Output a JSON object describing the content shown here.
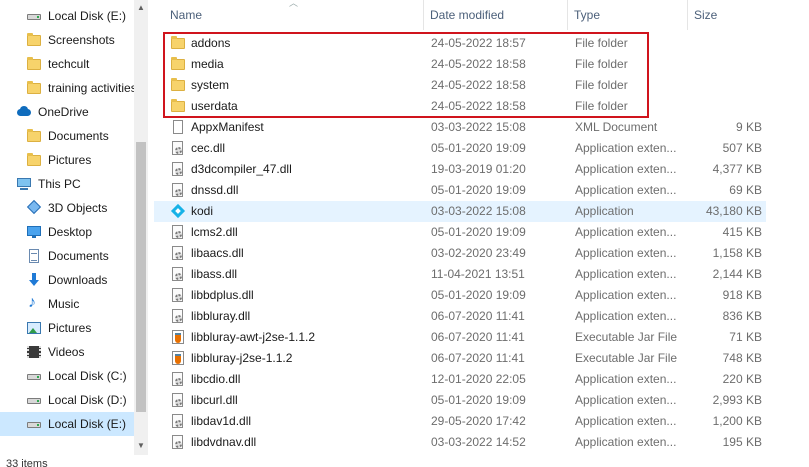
{
  "nav": {
    "items": [
      {
        "label": "Local Disk (E:)",
        "icon": "drive-icon",
        "indent": "sub"
      },
      {
        "label": "Screenshots",
        "icon": "folder-icon",
        "indent": "sub"
      },
      {
        "label": "techcult",
        "icon": "folder-icon",
        "indent": "sub"
      },
      {
        "label": "training activities",
        "icon": "folder-icon",
        "indent": "sub"
      },
      {
        "label": "OneDrive",
        "icon": "cloud-icon",
        "indent": "top"
      },
      {
        "label": "Documents",
        "icon": "folder-icon",
        "indent": "sub"
      },
      {
        "label": "Pictures",
        "icon": "folder-icon",
        "indent": "sub"
      },
      {
        "label": "This PC",
        "icon": "pc-icon",
        "indent": "top"
      },
      {
        "label": "3D Objects",
        "icon": "cube-icon",
        "indent": "sub"
      },
      {
        "label": "Desktop",
        "icon": "desk-icon",
        "indent": "sub"
      },
      {
        "label": "Documents",
        "icon": "doc-icon",
        "indent": "sub"
      },
      {
        "label": "Downloads",
        "icon": "dl-icon",
        "indent": "sub"
      },
      {
        "label": "Music",
        "icon": "music-icon",
        "indent": "sub"
      },
      {
        "label": "Pictures",
        "icon": "pic-icon",
        "indent": "sub"
      },
      {
        "label": "Videos",
        "icon": "vid-icon",
        "indent": "sub"
      },
      {
        "label": "Local Disk (C:)",
        "icon": "drive-icon",
        "indent": "sub"
      },
      {
        "label": "Local Disk (D:)",
        "icon": "drive-icon",
        "indent": "sub"
      },
      {
        "label": "Local Disk (E:)",
        "icon": "drive-icon",
        "indent": "sub",
        "selected": true
      }
    ]
  },
  "columns": {
    "name": "Name",
    "date": "Date modified",
    "type": "Type",
    "size": "Size"
  },
  "files": [
    {
      "name": "addons",
      "date": "24-05-2022 18:57",
      "type": "File folder",
      "size": "",
      "icon": "folder-icon"
    },
    {
      "name": "media",
      "date": "24-05-2022 18:58",
      "type": "File folder",
      "size": "",
      "icon": "folder-icon"
    },
    {
      "name": "system",
      "date": "24-05-2022 18:58",
      "type": "File folder",
      "size": "",
      "icon": "folder-icon"
    },
    {
      "name": "userdata",
      "date": "24-05-2022 18:58",
      "type": "File folder",
      "size": "",
      "icon": "folder-icon"
    },
    {
      "name": "AppxManifest",
      "date": "03-03-2022 15:08",
      "type": "XML Document",
      "size": "9 KB",
      "icon": "file-icon"
    },
    {
      "name": "cec.dll",
      "date": "05-01-2020 19:09",
      "type": "Application exten...",
      "size": "507 KB",
      "icon": "dll-icon"
    },
    {
      "name": "d3dcompiler_47.dll",
      "date": "19-03-2019 01:20",
      "type": "Application exten...",
      "size": "4,377 KB",
      "icon": "dll-icon"
    },
    {
      "name": "dnssd.dll",
      "date": "05-01-2020 19:09",
      "type": "Application exten...",
      "size": "69 KB",
      "icon": "dll-icon"
    },
    {
      "name": "kodi",
      "date": "03-03-2022 15:08",
      "type": "Application",
      "size": "43,180 KB",
      "icon": "kodi-icon",
      "highlight": true
    },
    {
      "name": "lcms2.dll",
      "date": "05-01-2020 19:09",
      "type": "Application exten...",
      "size": "415 KB",
      "icon": "dll-icon"
    },
    {
      "name": "libaacs.dll",
      "date": "03-02-2020 23:49",
      "type": "Application exten...",
      "size": "1,158 KB",
      "icon": "dll-icon"
    },
    {
      "name": "libass.dll",
      "date": "11-04-2021 13:51",
      "type": "Application exten...",
      "size": "2,144 KB",
      "icon": "dll-icon"
    },
    {
      "name": "libbdplus.dll",
      "date": "05-01-2020 19:09",
      "type": "Application exten...",
      "size": "918 KB",
      "icon": "dll-icon"
    },
    {
      "name": "libbluray.dll",
      "date": "06-07-2020 11:41",
      "type": "Application exten...",
      "size": "836 KB",
      "icon": "dll-icon"
    },
    {
      "name": "libbluray-awt-j2se-1.1.2",
      "date": "06-07-2020 11:41",
      "type": "Executable Jar File",
      "size": "71 KB",
      "icon": "jar-icon"
    },
    {
      "name": "libbluray-j2se-1.1.2",
      "date": "06-07-2020 11:41",
      "type": "Executable Jar File",
      "size": "748 KB",
      "icon": "jar-icon"
    },
    {
      "name": "libcdio.dll",
      "date": "12-01-2020 22:05",
      "type": "Application exten...",
      "size": "220 KB",
      "icon": "dll-icon"
    },
    {
      "name": "libcurl.dll",
      "date": "05-01-2020 19:09",
      "type": "Application exten...",
      "size": "2,993 KB",
      "icon": "dll-icon"
    },
    {
      "name": "libdav1d.dll",
      "date": "29-05-2020 17:42",
      "type": "Application exten...",
      "size": "1,200 KB",
      "icon": "dll-icon"
    },
    {
      "name": "libdvdnav.dll",
      "date": "03-03-2022 14:52",
      "type": "Application exten...",
      "size": "195 KB",
      "icon": "dll-icon"
    }
  ],
  "status": {
    "item_count": "33 items"
  },
  "colors": {
    "highlight_box": "#d0141d",
    "selected_bg": "#cce8ff",
    "hover_bg": "#e5f3ff"
  }
}
